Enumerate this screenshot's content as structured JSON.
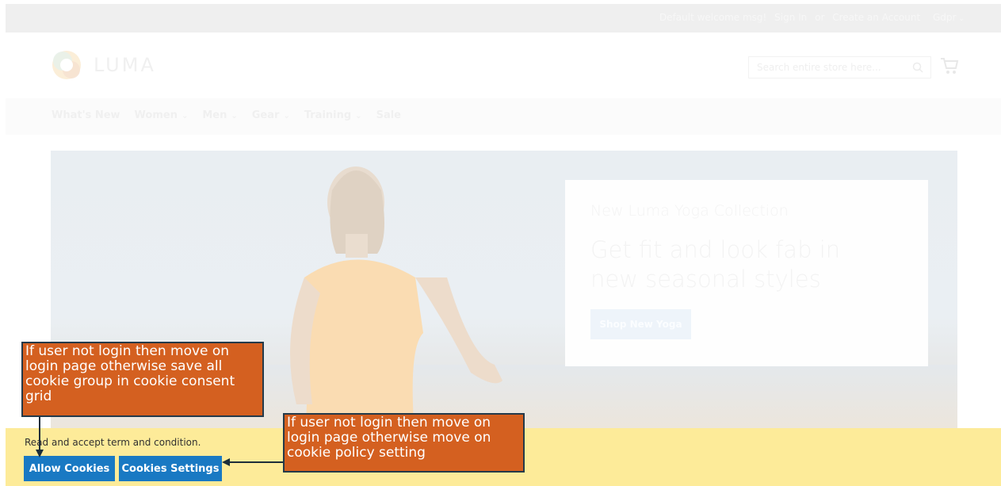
{
  "header": {
    "welcome": "Default welcome msg!",
    "sign_in": "Sign In",
    "or": "or",
    "create_account": "Create an Account",
    "gdpr": "Gdpr"
  },
  "brand": {
    "name": "LUMA"
  },
  "search": {
    "placeholder": "Search entire store here..."
  },
  "nav": {
    "items": [
      {
        "label": "What's New"
      },
      {
        "label": "Women"
      },
      {
        "label": "Men"
      },
      {
        "label": "Gear"
      },
      {
        "label": "Training"
      },
      {
        "label": "Sale"
      }
    ]
  },
  "hero": {
    "subtitle": "New Luma Yoga Collection",
    "headline": "Get fit and look fab in new seasonal styles",
    "button": "Shop New Yoga"
  },
  "cookie": {
    "message": "Read and accept term and condition.",
    "allow_label": "Allow Cookies",
    "settings_label": "Cookies Settings"
  },
  "annotations": {
    "allow_note": "If user not login then move on login page otherwise save all cookie group in cookie consent grid",
    "settings_note": "If user not login then move on login page otherwise move on cookie policy setting"
  },
  "colors": {
    "cookie_bar": "#fdeb99",
    "button_blue": "#1979c3",
    "annotation_orange": "#d46020"
  }
}
